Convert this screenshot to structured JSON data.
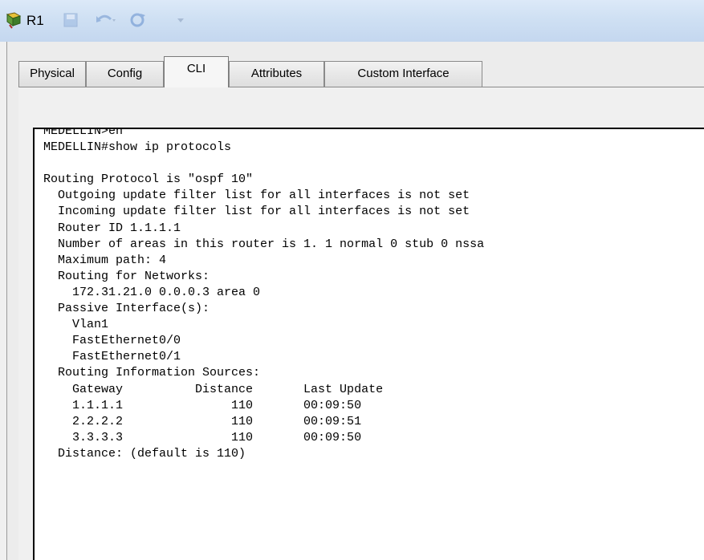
{
  "window": {
    "title": "R1",
    "icon": "router-icon"
  },
  "quick_access": [
    "save-icon",
    "undo-icon",
    "redo-icon",
    "extra-icon"
  ],
  "tabs": [
    {
      "label": "Physical",
      "active": false
    },
    {
      "label": "Config",
      "active": false
    },
    {
      "label": "CLI",
      "active": true
    },
    {
      "label": "Attributes",
      "active": false
    },
    {
      "label": "Custom Interface",
      "active": false
    }
  ],
  "cli": {
    "lines": [
      "MEDELLIN>en",
      "MEDELLIN#show ip protocols",
      "",
      "Routing Protocol is \"ospf 10\"",
      "  Outgoing update filter list for all interfaces is not set",
      "  Incoming update filter list for all interfaces is not set",
      "  Router ID 1.1.1.1",
      "  Number of areas in this router is 1. 1 normal 0 stub 0 nssa",
      "  Maximum path: 4",
      "  Routing for Networks:",
      "    172.31.21.0 0.0.0.3 area 0",
      "  Passive Interface(s):",
      "    Vlan1",
      "    FastEthernet0/0",
      "    FastEthernet0/1",
      "  Routing Information Sources:",
      "    Gateway          Distance       Last Update",
      "    1.1.1.1               110       00:09:50",
      "    2.2.2.2               110       00:09:51",
      "    3.3.3.3               110       00:09:50",
      "  Distance: (default is 110)"
    ]
  }
}
